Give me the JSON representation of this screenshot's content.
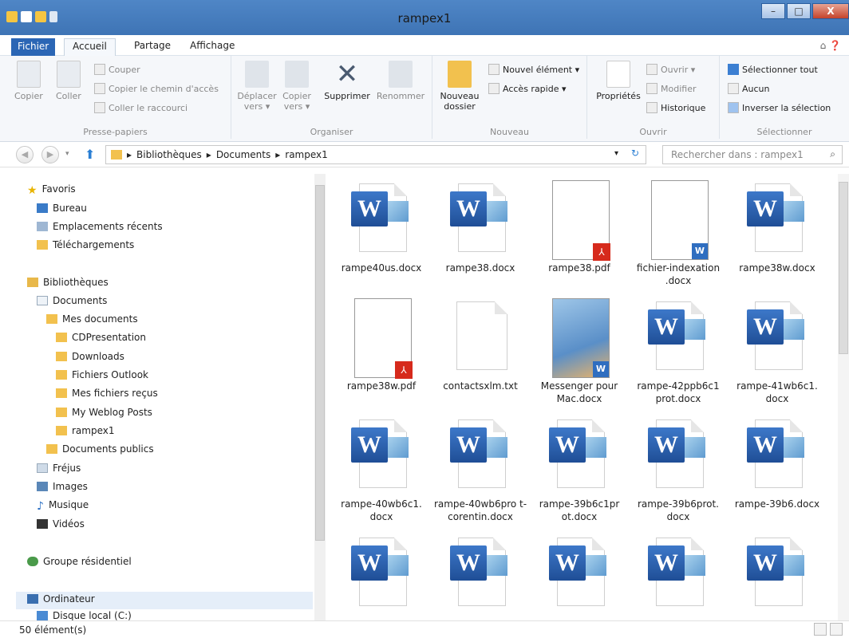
{
  "window": {
    "title": "rampex1",
    "minimize": "–",
    "maximize": "□",
    "close": "X"
  },
  "tabs": {
    "file": "Fichier",
    "home": "Accueil",
    "share": "Partage",
    "view": "Affichage"
  },
  "ribbon": {
    "clipboard": {
      "copy": "Copier",
      "paste": "Coller",
      "cut": "Couper",
      "copy_path": "Copier le chemin d'accès",
      "paste_shortcut": "Coller le raccourci",
      "label": "Presse-papiers"
    },
    "organize": {
      "move_to": "Déplacer vers ▾",
      "copy_to": "Copier vers ▾",
      "delete": "Supprimer",
      "rename": "Renommer",
      "label": "Organiser"
    },
    "new": {
      "new_folder": "Nouveau dossier",
      "new_item": "Nouvel élément ▾",
      "easy_access": "Accès rapide ▾",
      "label": "Nouveau"
    },
    "open": {
      "properties": "Propriétés",
      "open": "Ouvrir ▾",
      "edit": "Modifier",
      "history": "Historique",
      "label": "Ouvrir"
    },
    "select": {
      "select_all": "Sélectionner tout",
      "select_none": "Aucun",
      "invert": "Inverser la sélection",
      "label": "Sélectionner"
    }
  },
  "address": {
    "crumbs": [
      "Bibliothèques",
      "Documents",
      "rampex1"
    ],
    "search_placeholder": "Rechercher dans : rampex1"
  },
  "sidebar": {
    "favorites": "Favoris",
    "desktop": "Bureau",
    "recent": "Emplacements récents",
    "downloads": "Téléchargements",
    "libraries": "Bibliothèques",
    "documents": "Documents",
    "my_documents": "Mes documents",
    "cdpresentation": "CDPresentation",
    "downloads2": "Downloads",
    "outlook": "Fichiers Outlook",
    "received": "Mes fichiers reçus",
    "weblog": "My Weblog Posts",
    "rampex1": "rampex1",
    "public_docs": "Documents publics",
    "frejus": "Fréjus",
    "images": "Images",
    "music": "Musique",
    "videos": "Vidéos",
    "homegroup": "Groupe résidentiel",
    "computer": "Ordinateur",
    "local_disk": "Disque local (C:)"
  },
  "files": [
    {
      "name": "rampe40us.docx",
      "type": "word"
    },
    {
      "name": "rampe38.docx",
      "type": "word"
    },
    {
      "name": "rampe38.pdf",
      "type": "pdf"
    },
    {
      "name": "fichier-indexation .docx",
      "type": "wordthumb"
    },
    {
      "name": "rampe38w.docx",
      "type": "word"
    },
    {
      "name": "rampe38w.pdf",
      "type": "pdf"
    },
    {
      "name": "contactsxlm.txt",
      "type": "txt"
    },
    {
      "name": "Messenger pour Mac.docx",
      "type": "wordcover"
    },
    {
      "name": "rampe-42ppb6c1 prot.docx",
      "type": "word"
    },
    {
      "name": "rampe-41wb6c1. docx",
      "type": "word"
    },
    {
      "name": "rampe-40wb6c1. docx",
      "type": "word"
    },
    {
      "name": "rampe-40wb6pro t-corentin.docx",
      "type": "word"
    },
    {
      "name": "rampe-39b6c1pr ot.docx",
      "type": "word"
    },
    {
      "name": "rampe-39b6prot. docx",
      "type": "word"
    },
    {
      "name": "rampe-39b6.docx",
      "type": "word"
    },
    {
      "name": "",
      "type": "word"
    },
    {
      "name": "",
      "type": "word"
    },
    {
      "name": "",
      "type": "word"
    },
    {
      "name": "",
      "type": "word"
    },
    {
      "name": "",
      "type": "word"
    }
  ],
  "status": {
    "count": "50 élément(s)"
  }
}
